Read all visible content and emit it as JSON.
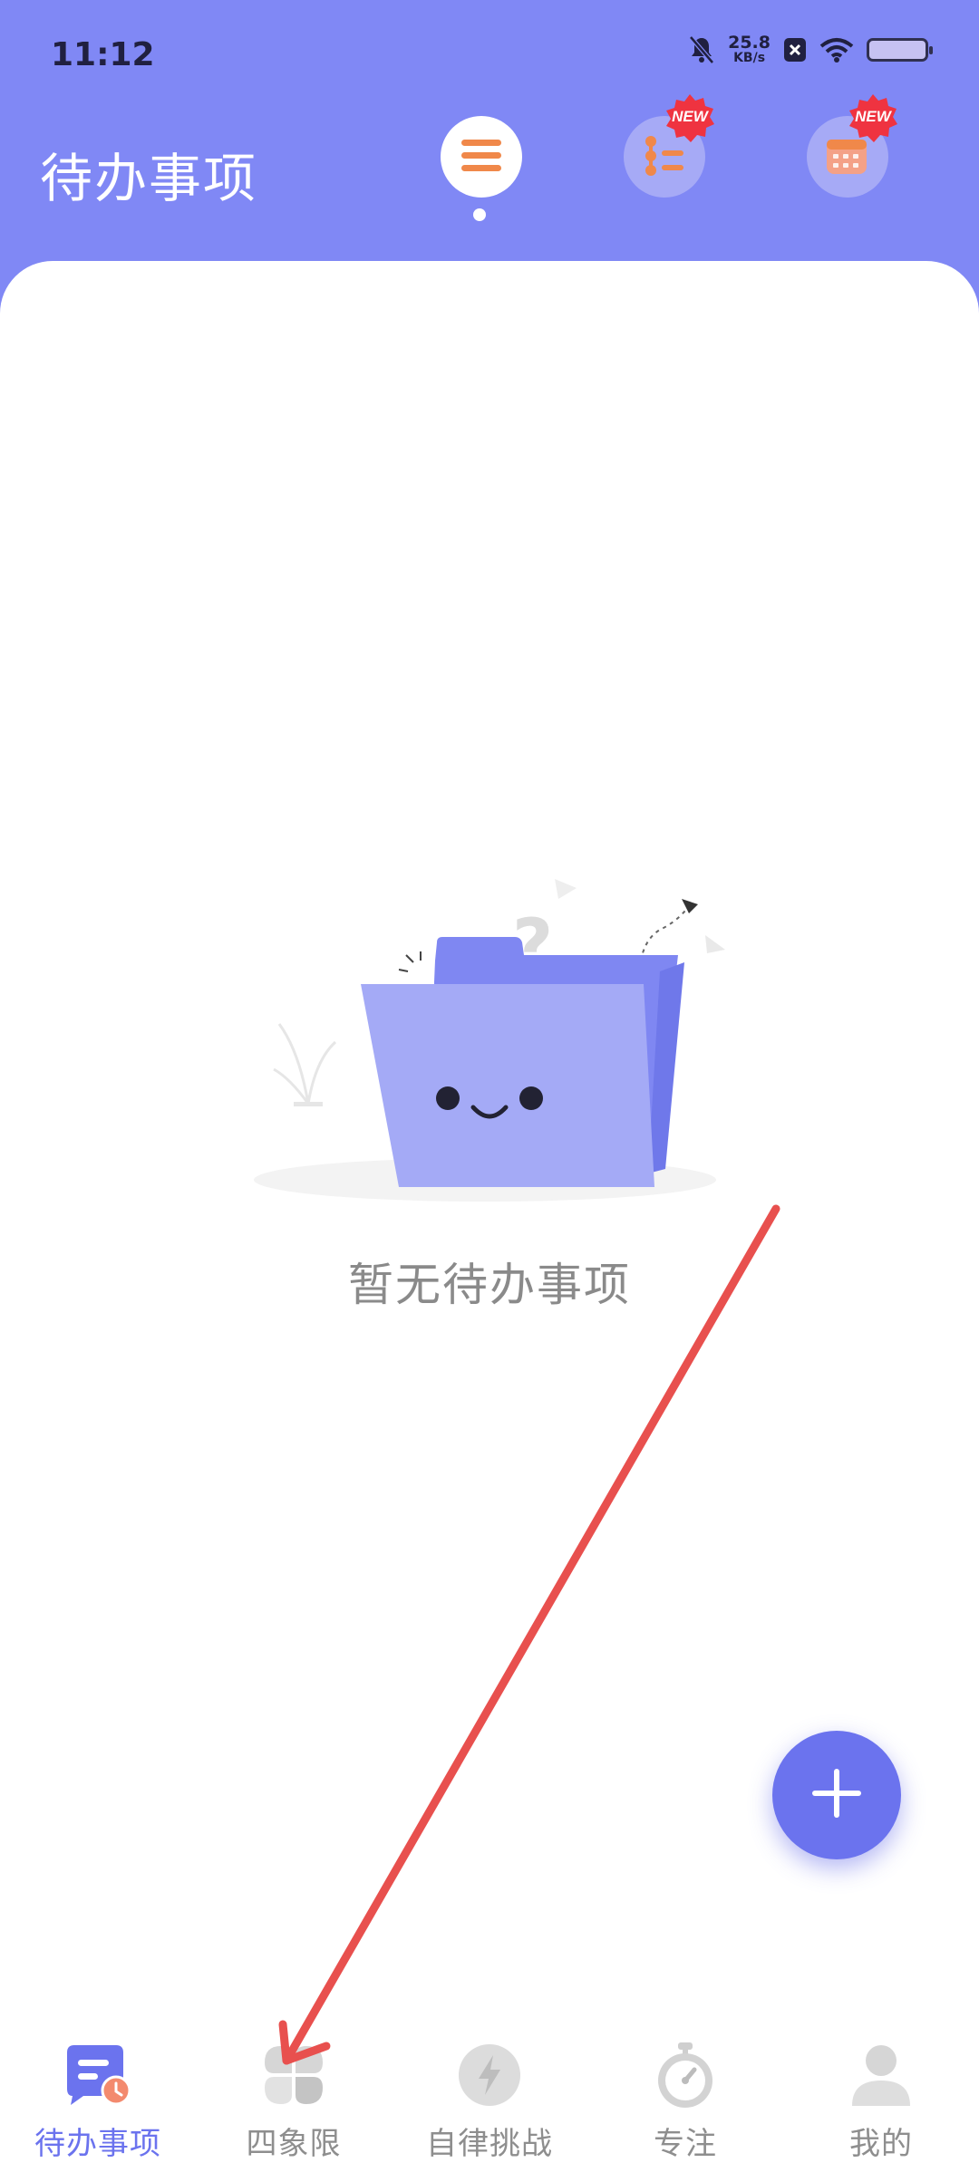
{
  "status_bar": {
    "time": "11:12",
    "net_speed_value": "25.8",
    "net_speed_unit": "KB/s",
    "icons": [
      "bell-off-icon",
      "x-app-icon",
      "wifi-icon",
      "battery-icon"
    ]
  },
  "header": {
    "title": "待办事项",
    "buttons": [
      {
        "name": "menu-icon",
        "active": true
      },
      {
        "name": "mind-map-icon",
        "badge": "NEW"
      },
      {
        "name": "calendar-icon",
        "badge": "NEW"
      }
    ]
  },
  "empty_state": {
    "text": "暂无待办事项",
    "illustration": "smiling-folder-icon"
  },
  "fab": {
    "icon": "plus-icon"
  },
  "bottom_nav": {
    "items": [
      {
        "label": "待办事项",
        "icon": "todo-list-icon",
        "active": true
      },
      {
        "label": "四象限",
        "icon": "quadrant-icon",
        "active": false
      },
      {
        "label": "自律挑战",
        "icon": "lightning-icon",
        "active": false
      },
      {
        "label": "专注",
        "icon": "stopwatch-icon",
        "active": false
      },
      {
        "label": "我的",
        "icon": "person-icon",
        "active": false
      }
    ]
  },
  "colors": {
    "primary": "#8088f5",
    "accent": "#6b73ee",
    "badge_red": "#ef3340",
    "annotation_arrow": "#e8504e"
  },
  "annotation": {
    "type": "arrow",
    "points_to": "bottom-nav-quadrant"
  }
}
